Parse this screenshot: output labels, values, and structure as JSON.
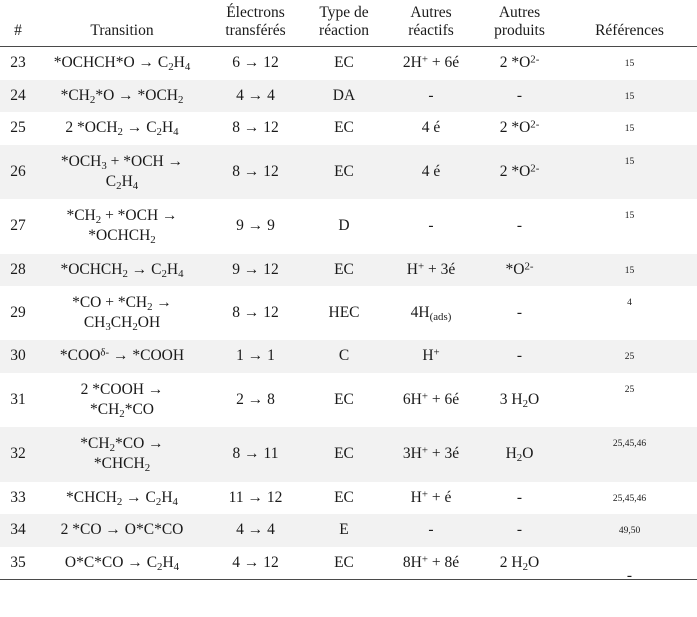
{
  "table": {
    "headers": [
      {
        "label": "#",
        "key": "num"
      },
      {
        "label": "Transition",
        "key": "transition"
      },
      {
        "label": "Électrons transférés",
        "key": "electrons",
        "line1": "Électrons",
        "line2": "transférés"
      },
      {
        "label": "Type de réaction",
        "key": "type",
        "line1": "Type de",
        "line2": "réaction"
      },
      {
        "label": "Autres réactifs",
        "key": "reactifs",
        "line1": "Autres",
        "line2": "réactifs"
      },
      {
        "label": "Autres produits",
        "key": "produits",
        "line1": "Autres",
        "line2": "produits"
      },
      {
        "label": "Références",
        "key": "references"
      }
    ],
    "rows": [
      {
        "num": "23",
        "transition_html": "*OCHCH*O &rarr; C<sub>2</sub>H<sub>4</sub>",
        "transition_text": "*OCHCH*O → C2H4",
        "electrons": "6 → 12",
        "type": "EC",
        "reactifs_html": "2H<sup>+</sup> + 6é",
        "reactifs_text": "2H+ + 6é",
        "produits_html": "2 *O<sup>2-</sup>",
        "produits_text": "2 *O2-",
        "references": "15",
        "stripe": false
      },
      {
        "num": "24",
        "transition_html": "*CH<sub>2</sub>*O &rarr; *OCH<sub>2</sub>",
        "transition_text": "*CH2*O → *OCH2",
        "electrons": "4 → 4",
        "type": "DA",
        "reactifs_html": "-",
        "reactifs_text": "-",
        "produits_html": "-",
        "produits_text": "-",
        "references": "15",
        "stripe": true
      },
      {
        "num": "25",
        "transition_html": "2 *OCH<sub>2</sub> &rarr; C<sub>2</sub>H<sub>4</sub>",
        "transition_text": "2 *OCH2 → C2H4",
        "electrons": "8 → 12",
        "type": "EC",
        "reactifs_html": "4 é",
        "reactifs_text": "4 é",
        "produits_html": "2 *O<sup>2-</sup>",
        "produits_text": "2 *O2-",
        "references": "15",
        "stripe": false
      },
      {
        "num": "26",
        "transition_html": "*OCH<sub>3</sub> + *OCH &rarr;<br>C<sub>2</sub>H<sub>4</sub>",
        "transition_text": "*OCH3 + *OCH → C2H4",
        "electrons": "8 → 12",
        "type": "EC",
        "reactifs_html": "4 é",
        "reactifs_text": "4 é",
        "produits_html": "2 *O<sup>2-</sup>",
        "produits_text": "2 *O2-",
        "references": "15",
        "stripe": true
      },
      {
        "num": "27",
        "transition_html": "*CH<sub>2</sub> + *OCH &rarr;<br>*OCHCH<sub>2</sub>",
        "transition_text": "*CH2 + *OCH → *OCHCH2",
        "electrons": "9 → 9",
        "type": "D",
        "reactifs_html": "-",
        "reactifs_text": "-",
        "produits_html": "-",
        "produits_text": "-",
        "references": "15",
        "stripe": false
      },
      {
        "num": "28",
        "transition_html": "*OCHCH<sub>2</sub> &rarr; C<sub>2</sub>H<sub>4</sub>",
        "transition_text": "*OCHCH2 → C2H4",
        "electrons": "9 → 12",
        "type": "EC",
        "reactifs_html": "H<sup>+</sup> + 3é",
        "reactifs_text": "H+ + 3é",
        "produits_html": "*O<sup>2-</sup>",
        "produits_text": "*O2-",
        "references": "15",
        "stripe": true
      },
      {
        "num": "29",
        "transition_html": "*CO + *CH<sub>2</sub> &rarr;<br>CH<sub>3</sub>CH<sub>2</sub>OH",
        "transition_text": "*CO + *CH2 → CH3CH2OH",
        "electrons": "8 → 12",
        "type": "HEC",
        "reactifs_html": "4H<sub>(ads)</sub>",
        "reactifs_text": "4H(ads)",
        "produits_html": "-",
        "produits_text": "-",
        "references": "4",
        "stripe": false
      },
      {
        "num": "30",
        "transition_html": "*COO<sup>&delta;-</sup> &rarr; *COOH",
        "transition_text": "*COOδ- → *COOH",
        "electrons": "1 → 1",
        "type": "C",
        "reactifs_html": "H<sup>+</sup>",
        "reactifs_text": "H+",
        "produits_html": "-",
        "produits_text": "-",
        "references": "25",
        "stripe": true
      },
      {
        "num": "31",
        "transition_html": "2 *COOH &rarr;<br>*CH<sub>2</sub>*CO",
        "transition_text": "2 *COOH → *CH2*CO",
        "electrons": "2 → 8",
        "type": "EC",
        "reactifs_html": "6H<sup>+</sup> + 6é",
        "reactifs_text": "6H+ + 6é",
        "produits_html": "3 H<sub>2</sub>O",
        "produits_text": "3 H2O",
        "references": "25",
        "stripe": false
      },
      {
        "num": "32",
        "transition_html": "*CH<sub>2</sub>*CO &rarr;<br>*CHCH<sub>2</sub>",
        "transition_text": "*CH2*CO → *CHCH2",
        "electrons": "8 → 11",
        "type": "EC",
        "reactifs_html": "3H<sup>+</sup> + 3é",
        "reactifs_text": "3H+ + 3é",
        "produits_html": "H<sub>2</sub>O",
        "produits_text": "H2O",
        "references": "25,45,46",
        "stripe": true
      },
      {
        "num": "33",
        "transition_html": "*CHCH<sub>2</sub> &rarr; C<sub>2</sub>H<sub>4</sub>",
        "transition_text": "*CHCH2 → C2H4",
        "electrons": "11 → 12",
        "type": "EC",
        "reactifs_html": "H<sup>+</sup> + é",
        "reactifs_text": "H+ + é",
        "produits_html": "-",
        "produits_text": "-",
        "references": "25,45,46",
        "stripe": false
      },
      {
        "num": "34",
        "transition_html": "2 *CO &rarr; O*C*CO",
        "transition_text": "2 *CO → O*C*CO",
        "electrons": "4 → 4",
        "type": "E",
        "reactifs_html": "-",
        "reactifs_text": "-",
        "produits_html": "-",
        "produits_text": "-",
        "references": "49,50",
        "stripe": true
      },
      {
        "num": "35",
        "transition_html": "O*C*CO &rarr; C<sub>2</sub>H<sub>4</sub>",
        "transition_text": "O*C*CO → C2H4",
        "electrons": "4 → 12",
        "type": "EC",
        "reactifs_html": "8H<sup>+</sup> + 8é",
        "reactifs_text": "8H+ + 8é",
        "produits_html": "2 H<sub>2</sub>O",
        "produits_text": "2 H2O",
        "references": "-",
        "stripe": false
      }
    ]
  },
  "style": {
    "stripe_color": "#f2f2f2",
    "border_color": "#4a4a4a",
    "text_color": "#1a1a1a",
    "background": "#ffffff"
  }
}
